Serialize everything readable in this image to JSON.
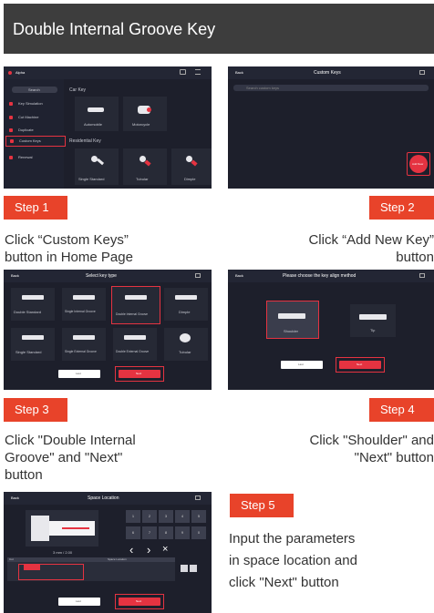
{
  "header": {
    "title": "Double Internal Groove Key"
  },
  "steps": [
    {
      "label": "Step 1",
      "caption": [
        "Click “Custom Keys”",
        "button in Home Page"
      ]
    },
    {
      "label": "Step 2",
      "caption": [
        "Click “Add New Key”",
        "button"
      ]
    },
    {
      "label": "Step 3",
      "caption": [
        "Click \"Double Internal",
        "Groove\" and \"Next\"",
        "button"
      ]
    },
    {
      "label": "Step 4",
      "caption": [
        "Click \"Shoulder\" and",
        "\"Next\" button"
      ]
    },
    {
      "label": "Step 5",
      "caption": [
        "Input the parameters",
        "in space location and",
        "click \"Next\" button"
      ]
    }
  ],
  "screen1": {
    "brand": "Alpha",
    "search": "Search",
    "sidebar": [
      "Key Simulation",
      "Cut Machine",
      "Duplicate",
      "Custom Keys",
      "Renewal"
    ],
    "car_section": "Car Key",
    "car_tiles": [
      "Automobile",
      "Motorcycle"
    ],
    "res_section": "Residential Key",
    "res_tiles": [
      "Single Standard",
      "Tubular",
      "Dimple"
    ]
  },
  "screen2": {
    "back": "Back",
    "title": "Custom Keys",
    "search_placeholder": "Search custom keys",
    "add_button": "Add New"
  },
  "screen3": {
    "back": "Back",
    "title": "Select key type",
    "types": [
      "Double Standard",
      "Single Internal Groove",
      "Double Internal Groove",
      "Dimple",
      "Single Standard",
      "Single External Groove",
      "Double External Groove",
      "Tubular"
    ],
    "cancel": "Last",
    "next": "Next"
  },
  "screen4": {
    "back": "Back",
    "title": "Please choose the key align method",
    "options": [
      "Shoulder",
      "Tip"
    ],
    "cancel": "Last",
    "next": "Next"
  },
  "screen5": {
    "back": "Back",
    "title": "Space Location",
    "dimension": "3 mm / 2.00",
    "keypad": [
      "1",
      "2",
      "3",
      "4",
      "5",
      "6",
      "7",
      "8",
      "9",
      "0"
    ],
    "nav": [
      "‹",
      "›",
      "×"
    ],
    "table_head": [
      "Cut",
      "Space Location"
    ],
    "cancel": "Last",
    "next": "Next"
  },
  "icons": [
    "key-icon",
    "car-key-icon",
    "motorcycle-key-icon",
    "gear-icon",
    "back-chevron-icon",
    "settings-icon",
    "plus-icon"
  ],
  "colors": {
    "accent": "#e8432a",
    "screen_bg": "#1d1f2b",
    "highlight": "#e53341",
    "header_bg": "#3d3d3d"
  }
}
